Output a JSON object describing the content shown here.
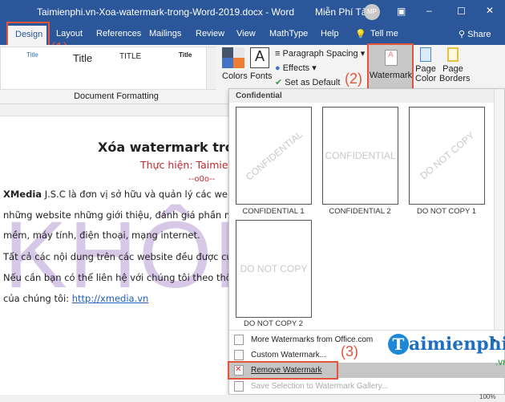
{
  "window": {
    "title": "Taimienphi.vn-Xoa-watermark-trong-Word-2019.docx  -  Word",
    "user": "Miễn Phí Tải",
    "avatar": "MP"
  },
  "tabs": [
    "Design",
    "Layout",
    "References",
    "Mailings",
    "Review",
    "View",
    "MathType",
    "Help",
    "Tell me",
    "Share"
  ],
  "ribbon": {
    "styles": [
      "Title",
      "Title",
      "TITLE",
      "Title"
    ],
    "colors": "Colors",
    "fonts": "Fonts",
    "paragraph_spacing": "Paragraph Spacing",
    "effects": "Effects",
    "set_default": "Set as Default",
    "watermark": "Watermark",
    "page_color": "Page Color",
    "page_borders": "Page Borders",
    "group_label": "Document Formatting"
  },
  "annotations": [
    "(1)",
    "(2)",
    "(3)"
  ],
  "document": {
    "title": "Xóa watermark trong",
    "subtitle": "Thực hiện: Taimien",
    "sep": "--o0o--",
    "bold": "XMedia",
    "lines": [
      " J.S.C là đơn vị sở hữu và quản lý các websi",
      "những website những giới thiệu, đánh giá phần m",
      "mềm, máy tính, điện thoại, mạng internet.",
      "Tất cả các nội dung trên các website đều được cu",
      "Nếu cần bạn có thể liên hệ với chúng tôi theo thô"
    ],
    "last_prefix": "của chúng tôi: ",
    "link": "http://xmedia.vn",
    "watermark": "KHÔNG"
  },
  "gallery": {
    "header": "Confidential",
    "items": [
      {
        "label": "CONFIDENTIAL 1",
        "text": "CONFIDENTIAL"
      },
      {
        "label": "CONFIDENTIAL 2",
        "text": "CONFIDENTIAL"
      },
      {
        "label": "DO NOT COPY 1",
        "text": "DO NOT COPY"
      },
      {
        "label": "DO NOT COPY 2",
        "text": "DO NOT COPY"
      }
    ]
  },
  "menu": [
    "More Watermarks from Office.com",
    "Custom Watermark...",
    "Remove Watermark",
    "Save Selection to Watermark Gallery..."
  ],
  "logo": {
    "text": "aimienphi",
    "suffix": ".vn"
  },
  "status": {
    "zoom": "100%"
  }
}
